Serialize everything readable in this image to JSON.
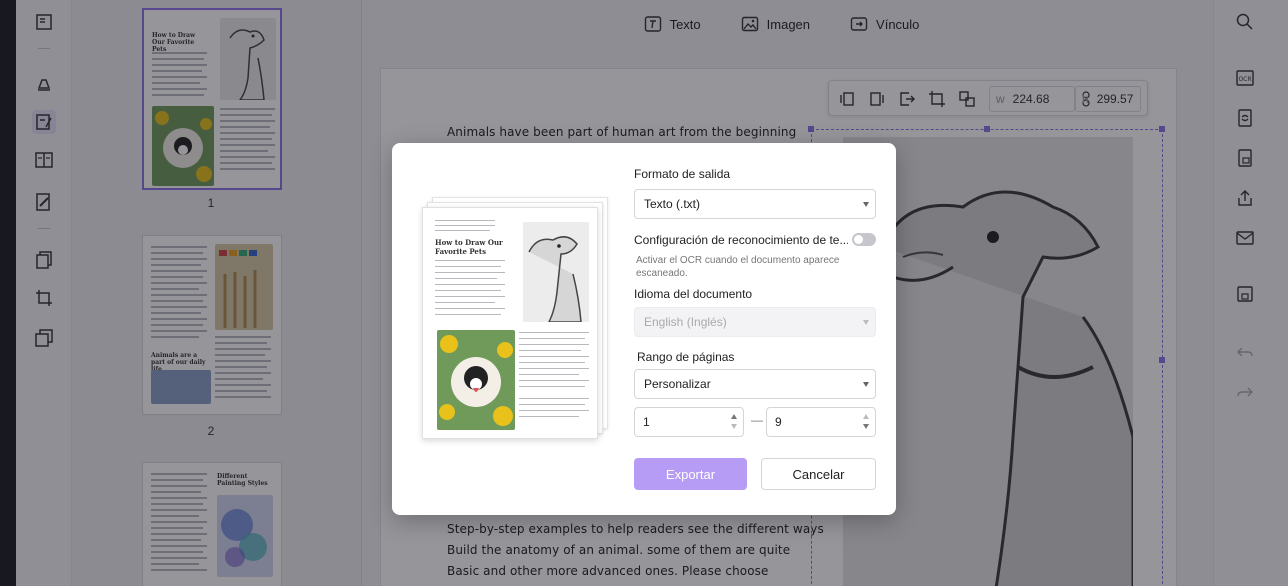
{
  "top_tools": [
    {
      "label": "Texto",
      "icon": "text-box-icon"
    },
    {
      "label": "Imagen",
      "icon": "image-icon"
    },
    {
      "label": "Vínculo",
      "icon": "link-icon"
    }
  ],
  "thumbnails": [
    {
      "number": "1",
      "title": "How to Draw Our Favorite Pets"
    },
    {
      "number": "2",
      "title": "Animals are a part of our daily life"
    },
    {
      "number": "",
      "title": "Different Painting Styles"
    }
  ],
  "image_toolbar": {
    "width_label": "w",
    "width_value": "224.68",
    "height_label": "h",
    "height_value": "299.57"
  },
  "document": {
    "line_top": "Animals have been part of human art from the beginning",
    "lines_bottom": [
      "Step-by-step examples to help readers see the different ways",
      "Build the anatomy of an animal. some of them are quite",
      "Basic and other more advanced ones. Please choose"
    ]
  },
  "dialog": {
    "preview_title": "How to Draw Our Favorite Pets",
    "output_format_label": "Formato de salida",
    "output_format_value": "Texto (.txt)",
    "ocr_label": "Configuración de reconocimiento de te...",
    "ocr_hint": "Activar el OCR cuando el documento aparece escaneado.",
    "language_label": "Idioma del documento",
    "language_value": "English (Inglés)",
    "range_label": "Rango de páginas",
    "range_value": "Personalizar",
    "range_from": "1",
    "range_separator": "—",
    "range_to": "9",
    "export_label": "Exportar",
    "cancel_label": "Cancelar"
  },
  "colors": {
    "accent": "#8f74e8",
    "primary_button": "#b79cf5"
  }
}
